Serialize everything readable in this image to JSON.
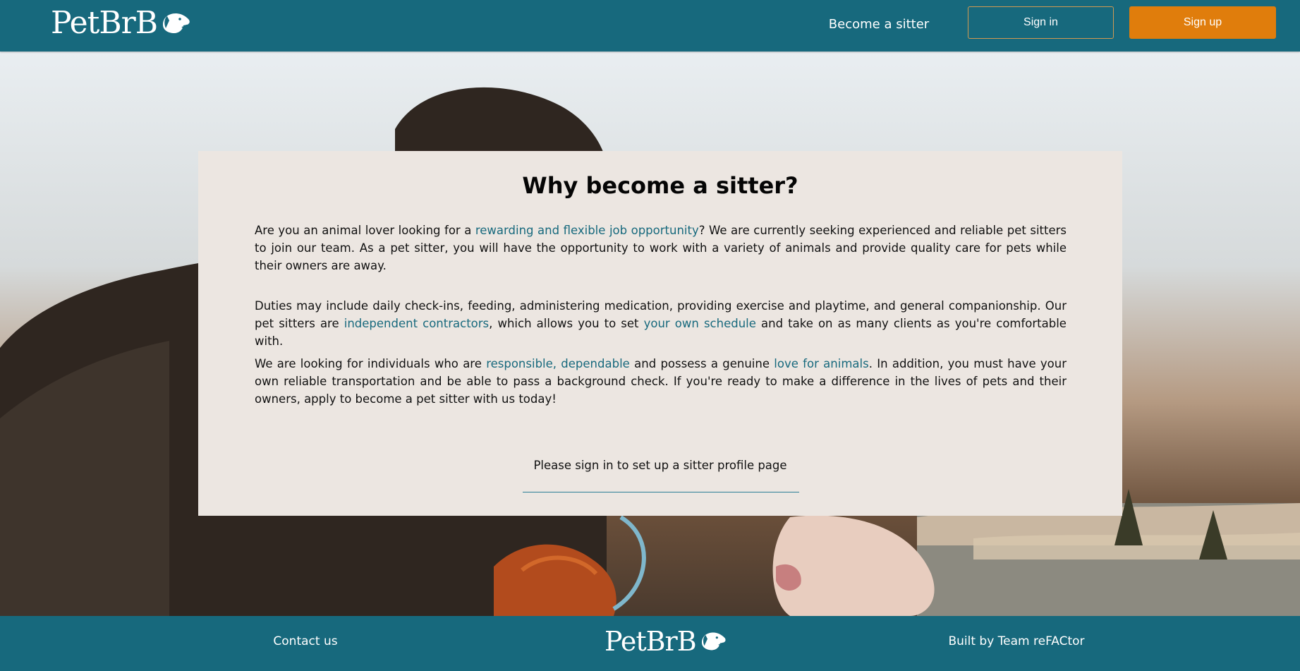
{
  "header": {
    "logo_text": "PetBrB",
    "become_sitter": "Become a sitter",
    "sign_in": "Sign in",
    "sign_up": "Sign up"
  },
  "main": {
    "title": "Why become a sitter?",
    "p1": {
      "a": "Are you an animal lover looking for a ",
      "b": "rewarding and flexible job opportunity",
      "c": "? We are currently seeking experienced and reliable pet sitters to join our team. As a pet sitter, you will have the opportunity to work with a variety of animals and provide quality care for pets while their owners are away."
    },
    "p2": {
      "a": "Duties may include daily check-ins, feeding, administering medication, providing exercise and playtime, and general companionship. Our pet sitters are ",
      "b": "independent contractors",
      "c": ", which allows you to set ",
      "d": "your own schedule",
      "e": " and take on as many clients as you're comfortable with."
    },
    "p3": {
      "a": "We are looking for individuals who are ",
      "b": "responsible, dependable",
      "c": " and possess a genuine ",
      "d": "love for animals",
      "e": ". In addition, you must have your own reliable transportation and be able to pass a background check. If you're ready to make a difference in the lives of pets and their owners, apply to become a pet sitter with us today!"
    },
    "signin_note": "Please sign in to set up a sitter profile page"
  },
  "footer": {
    "contact": "Contact us",
    "logo_text": "PetBrB",
    "built_by": "Built by Team reFACtor"
  },
  "colors": {
    "brand_teal": "#17697d",
    "accent_orange": "#e07d0c",
    "card_bg": "#ece6e1",
    "link_teal": "#17697d"
  },
  "icons": {
    "logo_mark": "dog-head-icon"
  }
}
